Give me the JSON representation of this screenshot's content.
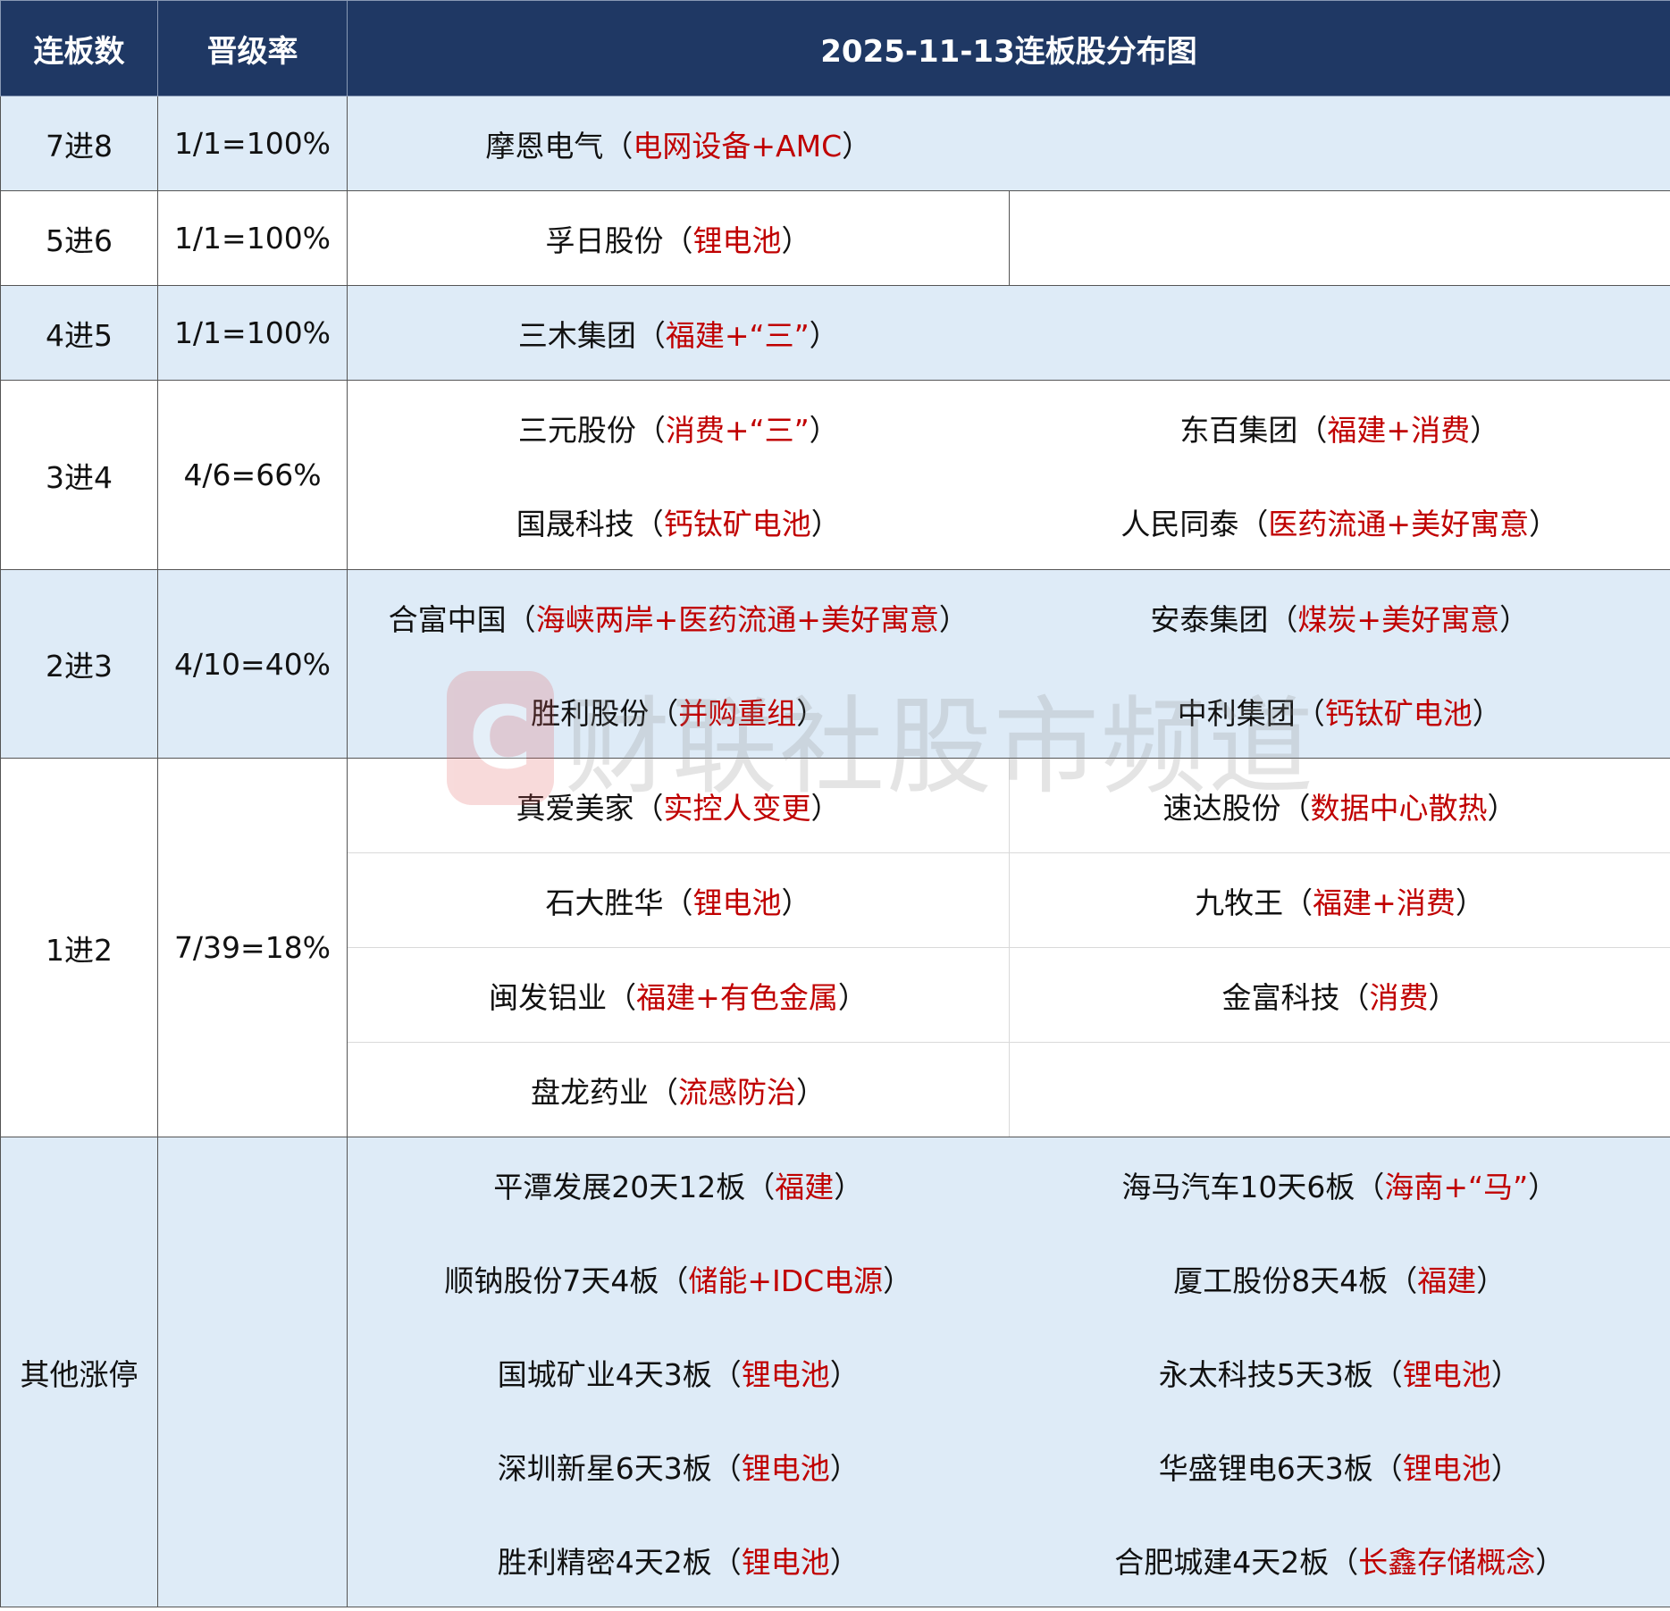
{
  "header": {
    "col_level": "连板数",
    "col_rate": "晋级率",
    "col_title": "2025-11-13连板股分布图"
  },
  "rows": [
    {
      "level": "7进8",
      "rate": "1/1=100%",
      "stocks": [
        {
          "name": "摩恩电气",
          "tag": "电网设备+AMC"
        }
      ]
    },
    {
      "level": "5进6",
      "rate": "1/1=100%",
      "stocks": [
        {
          "name": "孚日股份",
          "tag": "锂电池"
        }
      ]
    },
    {
      "level": "4进5",
      "rate": "1/1=100%",
      "stocks": [
        {
          "name": "三木集团",
          "tag": "福建+“三”"
        }
      ]
    },
    {
      "level": "3进4",
      "rate": "4/6=66%",
      "stocks": [
        {
          "name": "三元股份",
          "tag": "消费+“三”"
        },
        {
          "name": "东百集团",
          "tag": "福建+消费"
        },
        {
          "name": "国晟科技",
          "tag": "钙钛矿电池"
        },
        {
          "name": "人民同泰",
          "tag": "医药流通+美好寓意"
        }
      ]
    },
    {
      "level": "2进3",
      "rate": "4/10=40%",
      "stocks": [
        {
          "name": "合富中国",
          "tag": "海峡两岸+医药流通+美好寓意"
        },
        {
          "name": "安泰集团",
          "tag": "煤炭+美好寓意"
        },
        {
          "name": "胜利股份",
          "tag": "并购重组"
        },
        {
          "name": "中利集团",
          "tag": "钙钛矿电池"
        }
      ]
    },
    {
      "level": "1进2",
      "rate": "7/39=18%",
      "stocks": [
        {
          "name": "真爱美家",
          "tag": "实控人变更"
        },
        {
          "name": "速达股份",
          "tag": "数据中心散热"
        },
        {
          "name": "石大胜华",
          "tag": "锂电池"
        },
        {
          "name": "九牧王",
          "tag": "福建+消费"
        },
        {
          "name": "闽发铝业",
          "tag": "福建+有色金属"
        },
        {
          "name": "金富科技",
          "tag": "消费"
        },
        {
          "name": "盘龙药业",
          "tag": "流感防治"
        }
      ]
    },
    {
      "level": "其他涨停",
      "rate": "",
      "stocks": [
        {
          "name": "平潭发展20天12板",
          "tag": "福建"
        },
        {
          "name": "海马汽车10天6板",
          "tag": "海南+“马”"
        },
        {
          "name": "顺钠股份7天4板",
          "tag": "储能+IDC电源"
        },
        {
          "name": "厦工股份8天4板",
          "tag": "福建"
        },
        {
          "name": "国城矿业4天3板",
          "tag": "锂电池"
        },
        {
          "name": "永太科技5天3板",
          "tag": "锂电池"
        },
        {
          "name": "深圳新星6天3板",
          "tag": "锂电池"
        },
        {
          "name": "华盛锂电6天3板",
          "tag": "锂电池"
        },
        {
          "name": "胜利精密4天2板",
          "tag": "锂电池"
        },
        {
          "name": "合肥城建4天2板",
          "tag": "长鑫存储概念"
        }
      ]
    }
  ],
  "paren_open": "（",
  "paren_close": "）",
  "watermark": {
    "logo_letter": "C",
    "text": "财联社股市频道",
    "color": "#e05a5a"
  }
}
